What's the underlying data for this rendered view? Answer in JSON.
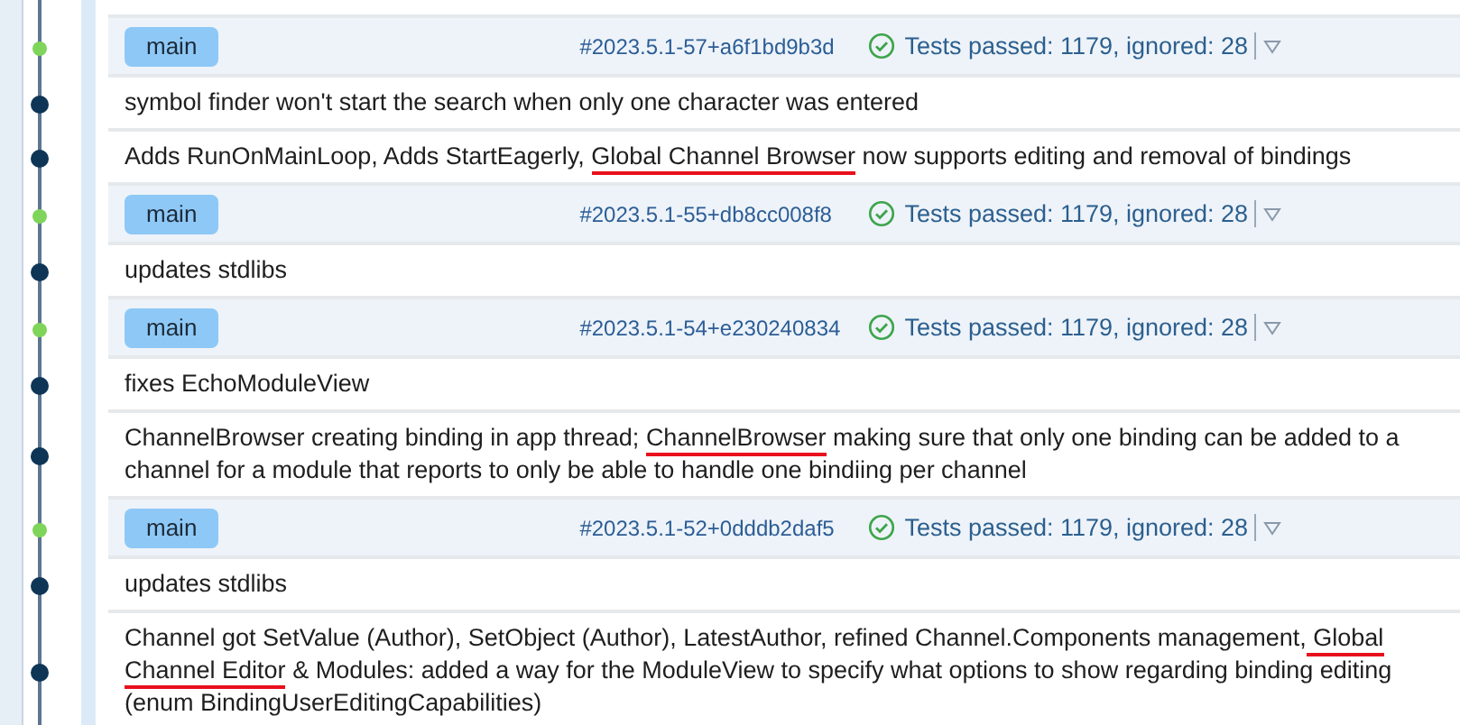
{
  "rows": [
    {
      "kind": "build",
      "branch": "main",
      "build": "#2023.5.1-57+a6f1bd9b3d",
      "tests_passed": true,
      "status_text": "Tests passed: 1179, ignored: 28"
    },
    {
      "kind": "commit",
      "message": [
        {
          "text": "symbol finder won't start the search when only one character was entered",
          "underlined": false
        }
      ]
    },
    {
      "kind": "commit",
      "message": [
        {
          "text": "Adds RunOnMainLoop, Adds StartEagerly, ",
          "underlined": false
        },
        {
          "text": "Global Channel Browser",
          "underlined": true
        },
        {
          "text": " now supports editing and removal of bindings",
          "underlined": false
        }
      ]
    },
    {
      "kind": "build",
      "branch": "main",
      "build": "#2023.5.1-55+db8cc008f8",
      "tests_passed": true,
      "status_text": "Tests passed: 1179, ignored: 28"
    },
    {
      "kind": "commit",
      "message": [
        {
          "text": "updates stdlibs",
          "underlined": false
        }
      ]
    },
    {
      "kind": "build",
      "branch": "main",
      "build": "#2023.5.1-54+e230240834",
      "tests_passed": true,
      "status_text": "Tests passed: 1179, ignored: 28"
    },
    {
      "kind": "commit",
      "message": [
        {
          "text": "fixes EchoModuleView",
          "underlined": false
        }
      ]
    },
    {
      "kind": "commit",
      "message": [
        {
          "text": "ChannelBrowser creating binding in app thread; ",
          "underlined": false
        },
        {
          "text": "ChannelBrowser",
          "underlined": true
        },
        {
          "text": " making sure that only one binding can be added to a channel for a module that reports to only be able to handle one bindiing per channel",
          "underlined": false
        }
      ]
    },
    {
      "kind": "build",
      "branch": "main",
      "build": "#2023.5.1-52+0dddb2daf5",
      "tests_passed": true,
      "status_text": "Tests passed: 1179, ignored: 28"
    },
    {
      "kind": "commit",
      "message": [
        {
          "text": "updates stdlibs",
          "underlined": false
        }
      ]
    },
    {
      "kind": "commit",
      "message": [
        {
          "text": "Channel got SetValue (Author), SetObject (Author), LatestAuthor, refined Channel.Components management,",
          "underlined": false
        },
        {
          "text": " Global Channel Editor",
          "underlined": true
        },
        {
          "text": " & Modules: added a way for the ModuleView to specify what options to show regarding binding editing (enum BindingUserEditingCapabilities)",
          "underlined": false
        }
      ]
    }
  ]
}
